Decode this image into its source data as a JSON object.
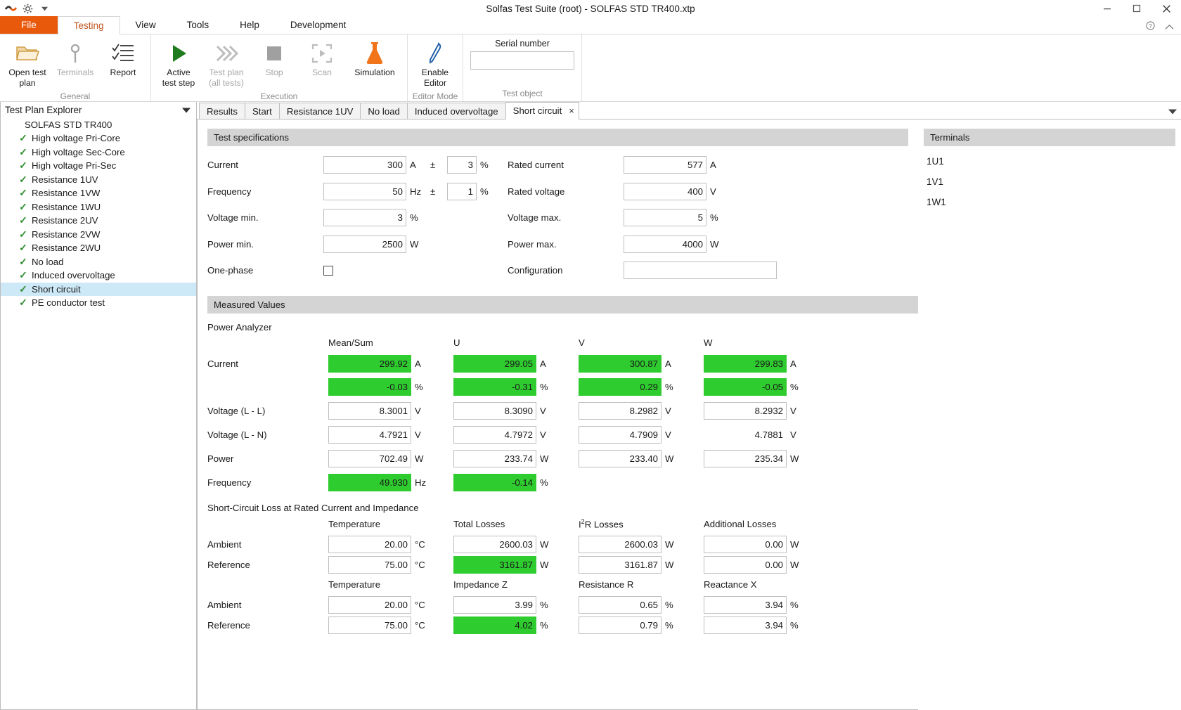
{
  "window": {
    "title": "Solfas Test Suite (root)  - SOLFAS STD TR400.xtp",
    "minimize": "minimize-icon",
    "maximize": "maximize-icon",
    "close": "close-icon",
    "qat": [
      "app-logo-icon",
      "gear-icon",
      "chevron-down-icon"
    ]
  },
  "ribbon": {
    "tabs": [
      {
        "label": "File",
        "active": false,
        "file": true
      },
      {
        "label": "Testing",
        "active": true
      },
      {
        "label": "View",
        "active": false
      },
      {
        "label": "Tools",
        "active": false
      },
      {
        "label": "Help",
        "active": false
      },
      {
        "label": "Development",
        "active": false
      }
    ],
    "groups": [
      {
        "label": "General",
        "buttons": [
          {
            "label": "Open test\nplan",
            "line1": "Open test",
            "line2": "plan",
            "disabled": false,
            "icon": "folder-open-icon"
          },
          {
            "label": "Terminals",
            "line1": "Terminals",
            "line2": "",
            "disabled": true,
            "icon": "terminals-icon"
          },
          {
            "label": "Report",
            "line1": "Report",
            "line2": "",
            "disabled": false,
            "icon": "checklist-icon"
          }
        ]
      },
      {
        "label": "Execution",
        "buttons": [
          {
            "line1": "Active",
            "line2": "test step",
            "disabled": false,
            "icon": "play-icon"
          },
          {
            "line1": "Test plan",
            "line2": "(all tests)",
            "disabled": true,
            "icon": "fast-forward-icon"
          },
          {
            "line1": "Stop",
            "line2": "",
            "disabled": true,
            "icon": "stop-icon"
          },
          {
            "line1": "Scan",
            "line2": "",
            "disabled": true,
            "icon": "scan-icon"
          },
          {
            "line1": "Simulation",
            "line2": "",
            "disabled": false,
            "icon": "flask-icon"
          }
        ]
      },
      {
        "label": "Editor Mode",
        "buttons": [
          {
            "line1": "Enable",
            "line2": "Editor",
            "disabled": false,
            "icon": "pencil-icon"
          }
        ]
      }
    ],
    "test_object": {
      "group_label": "Test object",
      "serial_label": "Serial number",
      "serial_value": "",
      "serial_placeholder": ""
    }
  },
  "sidebar": {
    "title": "Test Plan Explorer",
    "collapse_icon": "chevron-down-icon",
    "root": "SOLFAS STD TR400",
    "items": [
      {
        "label": "High voltage Pri-Core",
        "checked": true,
        "selected": false
      },
      {
        "label": "High voltage Sec-Core",
        "checked": true,
        "selected": false
      },
      {
        "label": "High voltage Pri-Sec",
        "checked": true,
        "selected": false
      },
      {
        "label": "Resistance 1UV",
        "checked": true,
        "selected": false
      },
      {
        "label": "Resistance 1VW",
        "checked": true,
        "selected": false
      },
      {
        "label": "Resistance 1WU",
        "checked": true,
        "selected": false
      },
      {
        "label": "Resistance 2UV",
        "checked": true,
        "selected": false
      },
      {
        "label": "Resistance 2VW",
        "checked": true,
        "selected": false
      },
      {
        "label": "Resistance 2WU",
        "checked": true,
        "selected": false
      },
      {
        "label": "No load",
        "checked": true,
        "selected": false
      },
      {
        "label": "Induced overvoltage",
        "checked": true,
        "selected": false
      },
      {
        "label": "Short circuit",
        "checked": true,
        "selected": true
      },
      {
        "label": "PE conductor test",
        "checked": true,
        "selected": false
      }
    ]
  },
  "tabs": {
    "items": [
      {
        "label": "Results",
        "active": false
      },
      {
        "label": "Start",
        "active": false
      },
      {
        "label": "Resistance 1UV",
        "active": false
      },
      {
        "label": "No load",
        "active": false
      },
      {
        "label": "Induced overvoltage",
        "active": false
      },
      {
        "label": "Short circuit",
        "active": true,
        "close": "×"
      }
    ],
    "overflow_icon": "chevron-down-icon"
  },
  "test_specifications": {
    "heading": "Test specifications",
    "rows": [
      {
        "label": "Current",
        "value": "300",
        "unit": "A",
        "pm": "±",
        "tol": "3",
        "tol_unit": "%",
        "label2": "Rated current",
        "value2": "577",
        "unit2": "A"
      },
      {
        "label": "Frequency",
        "value": "50",
        "unit": "Hz",
        "pm": "±",
        "tol": "1",
        "tol_unit": "%",
        "label2": "Rated voltage",
        "value2": "400",
        "unit2": "V"
      },
      {
        "label": "Voltage min.",
        "value": "3",
        "unit": "%",
        "pm": "",
        "tol": "",
        "tol_unit": "",
        "label2": "Voltage max.",
        "value2": "5",
        "unit2": "%"
      },
      {
        "label": "Power min.",
        "value": "2500",
        "unit": "W",
        "pm": "",
        "tol": "",
        "tol_unit": "",
        "label2": "Power max.",
        "value2": "4000",
        "unit2": "W"
      }
    ],
    "one_phase_label": "One-phase",
    "one_phase_checked": false,
    "configuration_label": "Configuration",
    "configuration_value": ""
  },
  "measured_values": {
    "heading": "Measured Values",
    "power_analyzer": {
      "title": "Power Analyzer",
      "columns": [
        "Mean/Sum",
        "U",
        "V",
        "W"
      ],
      "rows": [
        {
          "label": "Current",
          "cells": [
            {
              "value": "299.92",
              "unit": "A",
              "status": "ok"
            },
            {
              "value": "299.05",
              "unit": "A",
              "status": "ok"
            },
            {
              "value": "300.87",
              "unit": "A",
              "status": "ok"
            },
            {
              "value": "299.83",
              "unit": "A",
              "status": "ok"
            }
          ]
        },
        {
          "label": "",
          "cells": [
            {
              "value": "-0.03",
              "unit": "%",
              "status": "ok"
            },
            {
              "value": "-0.31",
              "unit": "%",
              "status": "ok"
            },
            {
              "value": "0.29",
              "unit": "%",
              "status": "ok"
            },
            {
              "value": "-0.05",
              "unit": "%",
              "status": "ok"
            }
          ]
        },
        {
          "label": "Voltage (L - L)",
          "cells": [
            {
              "value": "8.3001",
              "unit": "V",
              "status": "normal"
            },
            {
              "value": "8.3090",
              "unit": "V",
              "status": "normal"
            },
            {
              "value": "8.2982",
              "unit": "V",
              "status": "normal"
            },
            {
              "value": "8.2932",
              "unit": "V",
              "status": "normal"
            }
          ]
        },
        {
          "label": "Voltage (L - N)",
          "cells": [
            {
              "value": "4.7921",
              "unit": "V",
              "status": "normal"
            },
            {
              "value": "4.7972",
              "unit": "V",
              "status": "normal"
            },
            {
              "value": "4.7909",
              "unit": "V",
              "status": "normal"
            },
            {
              "value": "4.7881",
              "unit": "V",
              "status": "borderless"
            }
          ]
        },
        {
          "label": "Power",
          "cells": [
            {
              "value": "702.49",
              "unit": "W",
              "status": "normal"
            },
            {
              "value": "233.74",
              "unit": "W",
              "status": "normal"
            },
            {
              "value": "233.40",
              "unit": "W",
              "status": "normal"
            },
            {
              "value": "235.34",
              "unit": "W",
              "status": "normal"
            }
          ]
        },
        {
          "label": "Frequency",
          "cells": [
            {
              "value": "49.930",
              "unit": "Hz",
              "status": "ok"
            },
            {
              "value": "-0.14",
              "unit": "%",
              "status": "ok"
            },
            {
              "value": "",
              "unit": "",
              "status": "empty"
            },
            {
              "value": "",
              "unit": "",
              "status": "empty"
            }
          ]
        }
      ]
    },
    "short_circuit_loss": {
      "title": "Short-Circuit Loss at Rated Current and Impedance",
      "table1": {
        "columns": [
          "Temperature",
          "Total Losses",
          "I²R Losses",
          "Additional Losses"
        ],
        "rows": [
          {
            "label": "Ambient",
            "cells": [
              {
                "value": "20.00",
                "unit": "°C",
                "status": "normal"
              },
              {
                "value": "2600.03",
                "unit": "W",
                "status": "normal"
              },
              {
                "value": "2600.03",
                "unit": "W",
                "status": "normal"
              },
              {
                "value": "0.00",
                "unit": "W",
                "status": "normal"
              }
            ]
          },
          {
            "label": "Reference",
            "cells": [
              {
                "value": "75.00",
                "unit": "°C",
                "status": "normal"
              },
              {
                "value": "3161.87",
                "unit": "W",
                "status": "ok"
              },
              {
                "value": "3161.87",
                "unit": "W",
                "status": "normal"
              },
              {
                "value": "0.00",
                "unit": "W",
                "status": "normal"
              }
            ]
          }
        ]
      },
      "table2": {
        "columns": [
          "Temperature",
          "Impedance Z",
          "Resistance R",
          "Reactance X"
        ],
        "rows": [
          {
            "label": "Ambient",
            "cells": [
              {
                "value": "20.00",
                "unit": "°C",
                "status": "normal"
              },
              {
                "value": "3.99",
                "unit": "%",
                "status": "normal"
              },
              {
                "value": "0.65",
                "unit": "%",
                "status": "normal"
              },
              {
                "value": "3.94",
                "unit": "%",
                "status": "normal"
              }
            ]
          },
          {
            "label": "Reference",
            "cells": [
              {
                "value": "75.00",
                "unit": "°C",
                "status": "normal"
              },
              {
                "value": "4.02",
                "unit": "%",
                "status": "ok"
              },
              {
                "value": "0.79",
                "unit": "%",
                "status": "normal"
              },
              {
                "value": "3.94",
                "unit": "%",
                "status": "normal"
              }
            ]
          }
        ]
      }
    }
  },
  "terminals": {
    "heading": "Terminals",
    "items": [
      "1U1",
      "1V1",
      "1W1"
    ]
  },
  "colors": {
    "accent": "#e8590c",
    "ok_green": "#2ecc2e",
    "check_green": "#2f8f2f",
    "selection": "#cde8f6",
    "section_header": "#d4d4d4"
  }
}
